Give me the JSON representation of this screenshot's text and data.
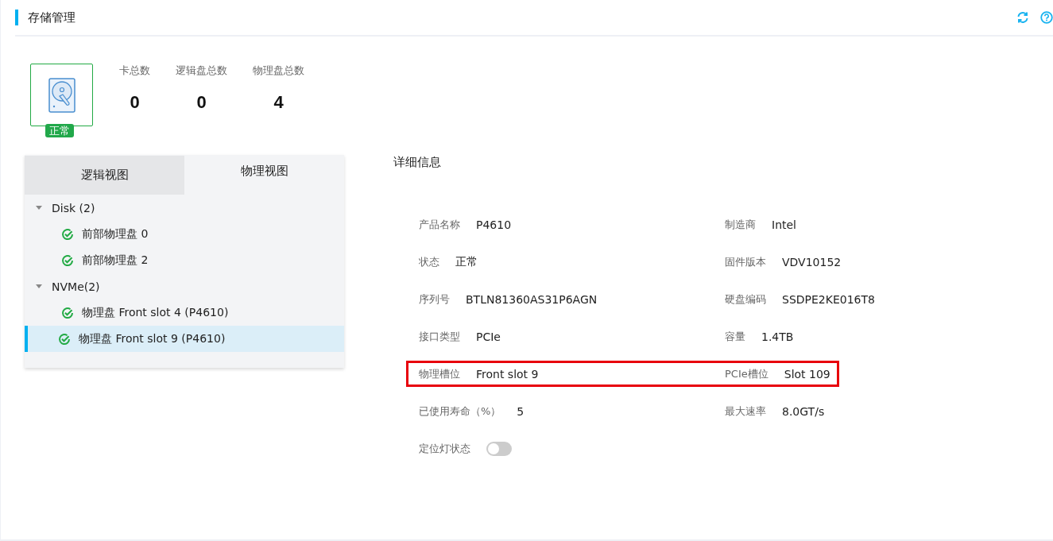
{
  "header": {
    "title": "存储管理"
  },
  "summary": {
    "status_badge": "正常",
    "stats": [
      {
        "label": "卡总数",
        "value": "0"
      },
      {
        "label": "逻辑盘总数",
        "value": "0"
      },
      {
        "label": "物理盘总数",
        "value": "4"
      }
    ]
  },
  "tree_panel": {
    "tabs": [
      {
        "label": "逻辑视图",
        "selected": false
      },
      {
        "label": "物理视图",
        "selected": true
      }
    ],
    "nodes": [
      {
        "label": "Disk (2)",
        "expanded": true,
        "children": [
          {
            "label": "前部物理盘 0",
            "selected": false
          },
          {
            "label": "前部物理盘 2",
            "selected": false
          }
        ]
      },
      {
        "label": "NVMe(2)",
        "expanded": true,
        "children": [
          {
            "label": "物理盘 Front slot 4 (P4610)",
            "selected": false
          },
          {
            "label": "物理盘 Front slot 9 (P4610)",
            "selected": true
          }
        ]
      }
    ]
  },
  "details": {
    "title": "详细信息",
    "rows": [
      {
        "highlighted": false,
        "fields": [
          {
            "label": "产品名称",
            "value": "P4610"
          },
          {
            "label": "制造商",
            "value": "Intel"
          }
        ]
      },
      {
        "highlighted": false,
        "fields": [
          {
            "label": "状态",
            "value": "正常"
          },
          {
            "label": "固件版本",
            "value": "VDV10152"
          }
        ]
      },
      {
        "highlighted": false,
        "fields": [
          {
            "label": "序列号",
            "value": "BTLN81360AS31P6AGN"
          },
          {
            "label": "硬盘编码",
            "value": "SSDPE2KE016T8"
          }
        ]
      },
      {
        "highlighted": false,
        "fields": [
          {
            "label": "接口类型",
            "value": "PCIe"
          },
          {
            "label": "容量",
            "value": "1.4TB"
          }
        ]
      },
      {
        "highlighted": true,
        "fields": [
          {
            "label": "物理槽位",
            "value": "Front slot 9"
          },
          {
            "label": "PCIe槽位",
            "value": "Slot 109"
          }
        ]
      },
      {
        "highlighted": false,
        "fields": [
          {
            "label": "已使用寿命（%）",
            "value": "5"
          },
          {
            "label": "最大速率",
            "value": "8.0GT/s"
          }
        ]
      }
    ],
    "locator_light": {
      "label": "定位灯状态",
      "on": false
    }
  }
}
